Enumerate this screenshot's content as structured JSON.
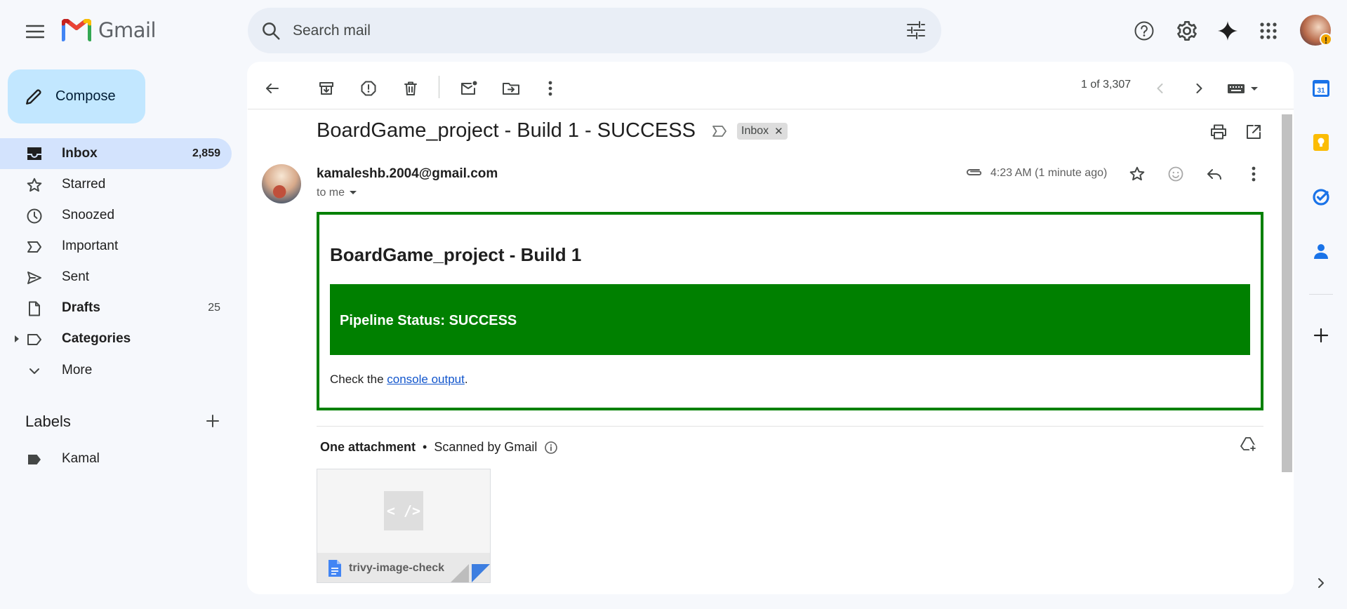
{
  "app": {
    "name": "Gmail"
  },
  "search": {
    "placeholder": "Search mail"
  },
  "sidebar": {
    "compose_label": "Compose",
    "items": [
      {
        "label": "Inbox",
        "count": "2,859",
        "icon": "inbox-icon"
      },
      {
        "label": "Starred",
        "count": "",
        "icon": "star-icon"
      },
      {
        "label": "Snoozed",
        "count": "",
        "icon": "clock-icon"
      },
      {
        "label": "Important",
        "count": "",
        "icon": "important-icon"
      },
      {
        "label": "Sent",
        "count": "",
        "icon": "send-icon"
      },
      {
        "label": "Drafts",
        "count": "25",
        "icon": "draft-icon"
      },
      {
        "label": "Categories",
        "count": "",
        "icon": "label-icon"
      },
      {
        "label": "More",
        "count": "",
        "icon": "chevron-down-icon"
      }
    ],
    "labels_heading": "Labels",
    "labels": [
      {
        "label": "Kamal"
      }
    ]
  },
  "toolbar": {
    "pager": "1 of 3,307"
  },
  "email": {
    "subject": "BoardGame_project - Build 1 - SUCCESS",
    "chip": "Inbox",
    "sender": "kamaleshb.2004@gmail.com",
    "to": "to me",
    "time": "4:23 AM (1 minute ago)",
    "body": {
      "heading": "BoardGame_project - Build 1",
      "status": "Pipeline Status: SUCCESS",
      "check_prefix": "Check the ",
      "link_text": "console output",
      "check_suffix": "."
    }
  },
  "attachments": {
    "heading": "One attachment",
    "scanned": "Scanned by Gmail",
    "file_name": "trivy-image-check",
    "thumb_glyph": "< />"
  },
  "colors": {
    "accent": "#0b57d0",
    "status_green": "#008000",
    "active_nav": "#d3e3fd",
    "compose": "#c2e7ff"
  }
}
